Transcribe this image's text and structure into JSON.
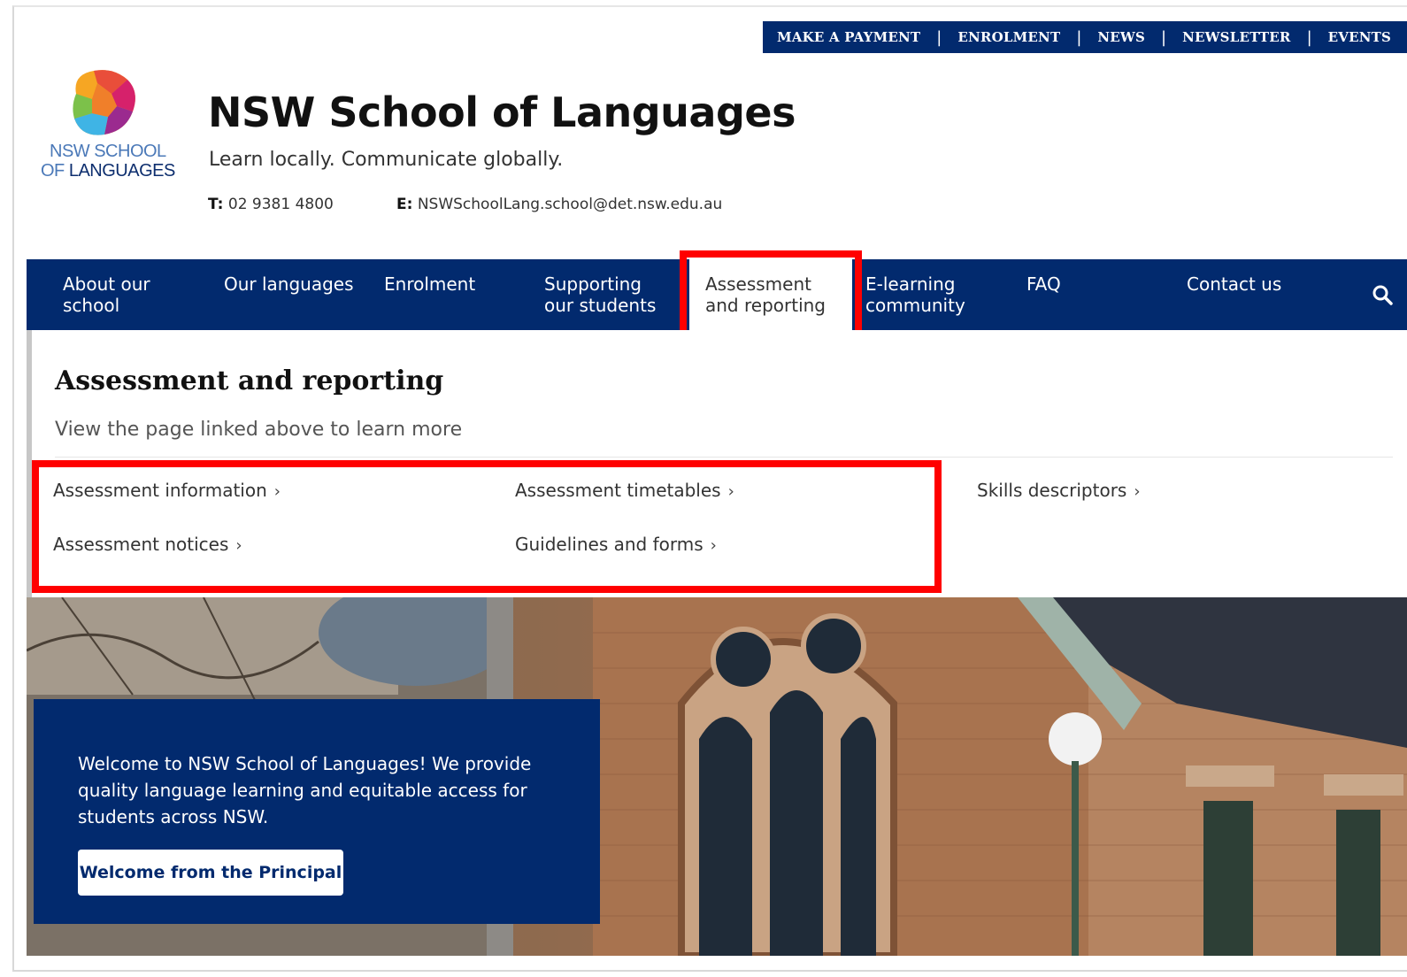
{
  "utility_nav": [
    "MAKE A PAYMENT",
    "ENROLMENT",
    "NEWS",
    "NEWSLETTER",
    "EVENTS"
  ],
  "logo": {
    "line1": "NSW SCHOOL",
    "line2_of": "OF",
    "line2_rest": "LANGUAGES"
  },
  "header": {
    "title": "NSW School of Languages",
    "tagline": "Learn locally. Communicate globally.",
    "phone_label": "T:",
    "phone": "02 9381 4800",
    "email_label": "E:",
    "email": "NSWSchoolLang.school@det.nsw.edu.au"
  },
  "main_nav": [
    "About our\nschool",
    "Our languages",
    "Enrolment",
    "Supporting\nour students",
    "Assessment\nand reporting",
    "E-learning\ncommunity",
    "FAQ",
    "Contact us"
  ],
  "mega_menu": {
    "title": "Assessment and reporting",
    "subtitle": "View the page linked above to learn more",
    "links": [
      "Assessment information",
      "Assessment timetables",
      "Skills descriptors",
      "Assessment notices",
      "Guidelines and forms"
    ]
  },
  "hero": {
    "welcome_text": "Welcome to NSW School of Languages! We provide quality language learning and equitable access for students across NSW.",
    "button_label": "Welcome from the Principal"
  },
  "colors": {
    "navy": "#022a6e",
    "highlight": "#ff0000"
  },
  "icons": [
    "school-logo-icon",
    "search-icon",
    "chevron-right-icon"
  ]
}
